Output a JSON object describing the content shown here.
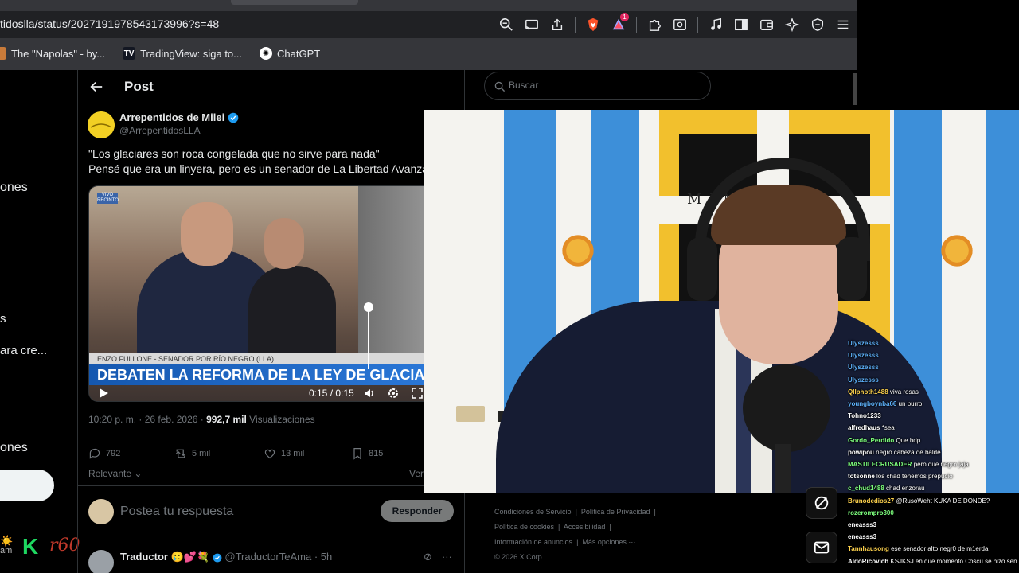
{
  "browser": {
    "url": "tidoslla/status/2027191978543173996?s=48",
    "bookmarks": [
      {
        "label": "The \"Napolas\" - by..."
      },
      {
        "label": "TradingView: siga to..."
      },
      {
        "label": "ChatGPT"
      }
    ],
    "notification_count": "1"
  },
  "nav": {
    "fragments": [
      "ones",
      "s",
      "ara cre...",
      "ones"
    ],
    "am": "am",
    "k": "K",
    "r60": "r60"
  },
  "post": {
    "header_title": "Post",
    "author_name": "Arrepentidos de Milei",
    "author_handle": "@ArrepentidosLLA",
    "text_line1": "\"Los glaciares son roca congelada que no sirve para nada\"",
    "text_line2": "Pensé que era un linyera, pero es un senador de La Libertad Avanza",
    "video": {
      "badge": "VIVO RECINTO",
      "lower_third_label": "ENZO FULLONE - SENADOR POR RÍO NEGRO (LLA)",
      "headline": "DEBATEN LA REFORMA DE LA LEY DE GLACIARES",
      "time": "0:15 / 0:15",
      "volume_level": 1.0
    },
    "meta_time": "10:20 p. m. · 26 feb. 2026 ·",
    "meta_views_count": "992,7 mil",
    "meta_views_label": "Visualizaciones",
    "replies": "792",
    "reposts": "5 mil",
    "likes": "13 mil",
    "bookmarks": "815",
    "sort_label": "Relevante",
    "ver_label": "Ver",
    "reply_placeholder": "Postea tu respuesta",
    "reply_button": "Responder",
    "next_author": "Traductor",
    "next_emojis": "🥲💕💐",
    "next_handle": "@TraductorTeAma · 5h"
  },
  "right": {
    "search_placeholder": "Buscar",
    "footer": {
      "line1a": "Condiciones de Servicio",
      "line1b": "Política de Privacidad",
      "line2a": "Política de cookies",
      "line2b": "Accesibilidad",
      "line3a": "Información de anuncios",
      "line3b": "Más opciones ···",
      "line4": "© 2026 X Corp."
    }
  },
  "webcam": {
    "flag_text": "M           UNS"
  },
  "chat": [
    {
      "user": "Ulyszesss",
      "msg": "",
      "color": "#5fb4ff"
    },
    {
      "user": "Ulyszesss",
      "msg": "",
      "color": "#5fb4ff"
    },
    {
      "user": "Ulyszesss",
      "msg": "",
      "color": "#5fb4ff"
    },
    {
      "user": "Ulyszesss",
      "msg": "",
      "color": "#5fb4ff"
    },
    {
      "user": "Qllphoth1488",
      "msg": "viva rosas",
      "color": "#ffd34d"
    },
    {
      "user": "youngboynba66",
      "msg": "un burro",
      "color": "#5fb4ff"
    },
    {
      "user": "Tohno1233",
      "msg": "",
      "color": "#ffffff"
    },
    {
      "user": "alfredhaus",
      "msg": "*sea",
      "color": "#ffffff"
    },
    {
      "user": "Gordo_Perdido",
      "msg": "Que hdp",
      "color": "#7dff7d"
    },
    {
      "user": "powipou",
      "msg": "negro cabeza de balde",
      "color": "#ffffff"
    },
    {
      "user": "MASTILECRUSADER",
      "msg": "pero que negro jaja",
      "color": "#7dff7d"
    },
    {
      "user": "totsonne",
      "msg": "los chad tenemos prepucio",
      "color": "#ffffff"
    },
    {
      "user": "c_chud1488",
      "msg": "chad enzorau",
      "color": "#7dff7d"
    },
    {
      "user": "Brunodedios27",
      "msg": "@RusoWeht KUKA DE DONDE?",
      "color": "#ffd34d"
    },
    {
      "user": "rozerompro300",
      "msg": "",
      "color": "#7dff7d"
    },
    {
      "user": "eneasss3",
      "msg": "",
      "color": "#ffffff"
    },
    {
      "user": "eneasss3",
      "msg": "",
      "color": "#ffffff"
    },
    {
      "user": "Tannhausong",
      "msg": "ese senador alto negr0 de m1erda",
      "color": "#ffd34d"
    },
    {
      "user": "AldoRicovich",
      "msg": "KSJKSJ en que momento Coscu se hizo sen",
      "color": "#ffffff"
    }
  ],
  "colors": {
    "x_background": "#000000",
    "chrome": "#35363a",
    "argentina_blue": "#3d8fd9",
    "flag_gold": "#f2c02d"
  }
}
